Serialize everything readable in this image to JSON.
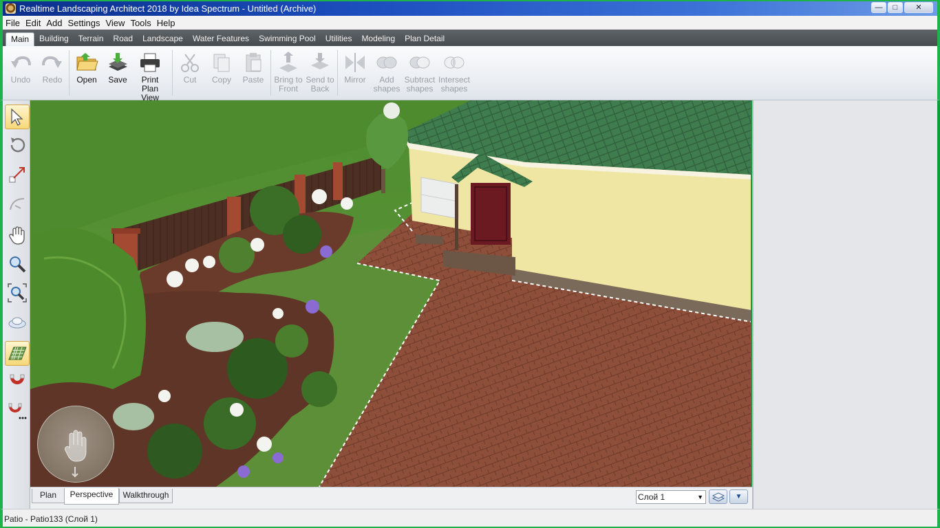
{
  "window": {
    "title": "Realtime Landscaping Architect 2018 by Idea Spectrum - Untitled (Archive)"
  },
  "menu": [
    "File",
    "Edit",
    "Add",
    "Settings",
    "View",
    "Tools",
    "Help"
  ],
  "tabs": [
    "Main",
    "Building",
    "Terrain",
    "Road",
    "Landscape",
    "Water Features",
    "Swimming Pool",
    "Utilities",
    "Modeling",
    "Plan Detail"
  ],
  "ribbon": {
    "undo": "Undo",
    "redo": "Redo",
    "open": "Open",
    "save": "Save",
    "print_l1": "Print Plan",
    "print_l2": "View",
    "cut": "Cut",
    "copy": "Copy",
    "paste": "Paste",
    "front_l1": "Bring to",
    "front_l2": "Front",
    "back_l1": "Send to",
    "back_l2": "Back",
    "mirror": "Mirror",
    "add_l1": "Add",
    "add_l2": "shapes",
    "sub_l1": "Subtract",
    "sub_l2": "shapes",
    "int_l1": "Intersect",
    "int_l2": "shapes"
  },
  "left_tools": [
    "select-arrow-icon",
    "rotate-icon",
    "resize-icon",
    "curve-icon",
    "pan-hand-icon",
    "zoom-icon",
    "zoom-extents-icon",
    "camera-orbit-icon",
    "grid-icon",
    "snap-magnet-icon",
    "snap-settings-icon"
  ],
  "view_tabs": [
    "Plan",
    "Perspective",
    "Walkthrough"
  ],
  "layer": {
    "selected": "Слой 1"
  },
  "status": {
    "text": "Patio - Patio133 (Слой 1)"
  },
  "colors": {
    "title_bar": "#1d4fbf",
    "tab_strip": "#555b5f",
    "lawn": "#5e8d3a",
    "paving": "#8e4f3a",
    "roof": "#3e7a4d",
    "wall": "#efe6a3",
    "fence": "#4a2d22",
    "door": "#6b1a22"
  }
}
